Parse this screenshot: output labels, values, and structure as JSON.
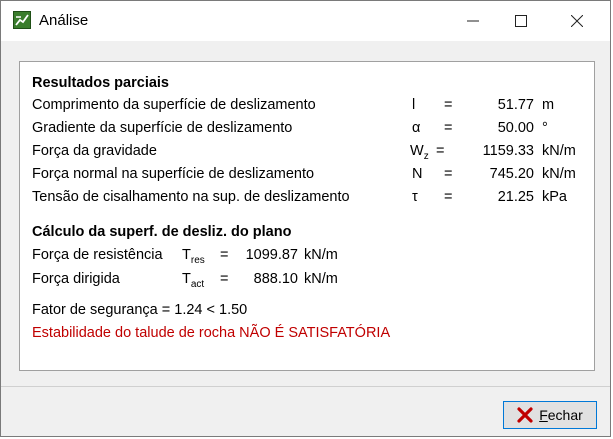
{
  "window": {
    "title": "Análise",
    "minimize_glyph": "—",
    "maximize_glyph": "☐",
    "close_glyph": "✕"
  },
  "partial": {
    "heading": "Resultados parciais",
    "rows": [
      {
        "label": "Comprimento da superfície de deslizamento",
        "symbol": "l",
        "sub": "",
        "eq": "=",
        "value": "51.77",
        "unit": "m"
      },
      {
        "label": "Gradiente da superfície de deslizamento",
        "symbol": "α",
        "sub": "",
        "eq": "=",
        "value": "50.00",
        "unit": "°"
      },
      {
        "label": "Força da gravidade",
        "symbol": "W",
        "sub": "z",
        "eq": "=",
        "value": "1159.33",
        "unit": "kN/m"
      },
      {
        "label": "Força normal na superfície de deslizamento",
        "symbol": "N",
        "sub": "",
        "eq": "=",
        "value": "745.20",
        "unit": "kN/m"
      },
      {
        "label": "Tensão de cisalhamento na sup. de deslizamento",
        "symbol": "τ",
        "sub": "",
        "eq": "=",
        "value": "21.25",
        "unit": "kPa"
      }
    ]
  },
  "plane": {
    "heading": "Cálculo da superf. de desliz. do plano",
    "rows": [
      {
        "label": "Força de resistência",
        "symbol": "T",
        "sub": "res",
        "eq": "=",
        "value": "1099.87",
        "unit": "kN/m"
      },
      {
        "label": "Força dirigida",
        "symbol": "T",
        "sub": "act",
        "eq": "=",
        "value": "888.10",
        "unit": "kN/m"
      }
    ],
    "safety_factor": "Fator de segurança = 1.24 < 1.50",
    "verdict": "Estabilidade do talude de rocha NÃO É SATISFATÓRIA"
  },
  "buttons": {
    "close_label_first": "F",
    "close_label_rest": "echar"
  },
  "colors": {
    "verdict": "#c00000",
    "close_icon": "#c00000"
  }
}
